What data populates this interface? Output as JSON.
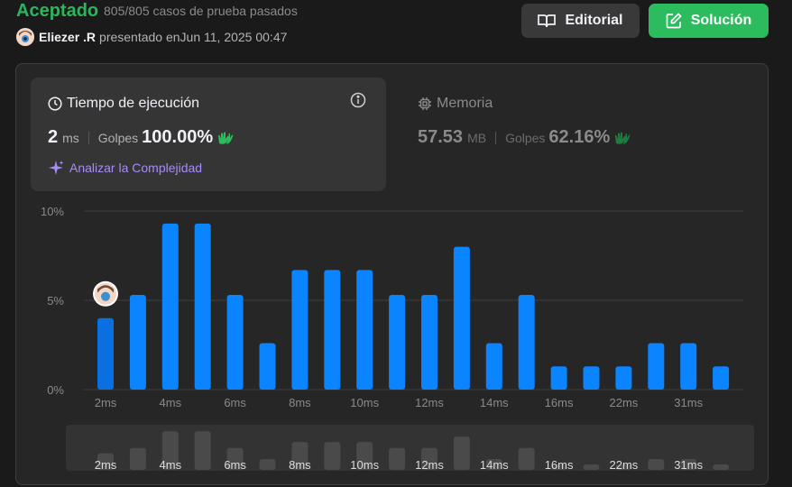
{
  "header": {
    "status": "Aceptado",
    "cases": "805/805 casos de prueba pasados",
    "author": "Eliezer .R",
    "submitted": "presentado enJun 11, 2025 00:47",
    "editorial_label": "Editorial",
    "solution_label": "Solución"
  },
  "runtime": {
    "title": "Tiempo de ejecución",
    "value": "2",
    "unit": "ms",
    "beats_label": "Golpes",
    "beats": "100.00%",
    "analyze": "Analizar la Complejidad"
  },
  "memory": {
    "title": "Memoria",
    "value": "57.53",
    "unit": "MB",
    "beats_label": "Golpes",
    "beats": "62.16%"
  },
  "colors": {
    "accepted": "#2db55d",
    "bar": "#0a84ff",
    "bar_selected": "#0a6fe0",
    "mini_bar": "#4a4a4a",
    "analyze": "#a78bfa"
  },
  "chart_data": {
    "type": "bar",
    "ylim": [
      0,
      10
    ],
    "y_ticks": [
      "0%",
      "5%",
      "10%"
    ],
    "x_tick_labels": [
      "2ms",
      "4ms",
      "6ms",
      "8ms",
      "10ms",
      "12ms",
      "14ms",
      "16ms",
      "22ms",
      "31ms"
    ],
    "x_tick_bars": [
      0,
      2,
      4,
      6,
      8,
      10,
      12,
      14,
      16,
      18
    ],
    "values": [
      4.0,
      5.3,
      9.3,
      9.3,
      5.3,
      2.6,
      6.7,
      6.7,
      6.7,
      5.3,
      5.3,
      8.0,
      2.6,
      5.3,
      1.3,
      1.3,
      1.3,
      2.6,
      2.6,
      1.3
    ],
    "selected_index": 0,
    "grid": true
  }
}
